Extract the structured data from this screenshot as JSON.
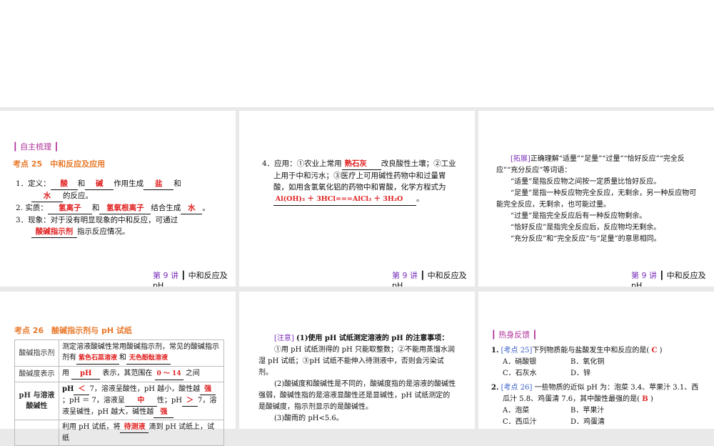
{
  "slide1": {
    "section": "自主梳理",
    "kaodian": "考点 25　中和反应及应用",
    "l1a": "1．定义：",
    "b_acid": "酸",
    "and1": "和",
    "b_base": "碱",
    "mid1": "作用生成",
    "b_salt": "盐",
    "and2": "和",
    "b_water": "水",
    "end1": "的反应。",
    "l2a": "2. 实质：",
    "b_h": "氢离子",
    "and3": "和",
    "b_oh": "氢氧根离子",
    "mid2": "结合生成",
    "b_water2": "水",
    "end2": "。",
    "l3a": "3．现象：对于没有明显现象的中和反应，可通过",
    "b_ind": "酸碱指示剂",
    "end3": "指示反应情况。"
  },
  "slide2": {
    "l1": "4．应用：①农业上常用",
    "b_lime": "熟石灰",
    "l1b": "改良酸性土壤；②工业上用于中和污水；③医疗上可用碱性药物中和过量胃酸，如用含氢氧化铝的药物中和胃酸，化学方程式为",
    "b_eq": "Al(OH)₃ ＋ 3HCl===AlCl₃ ＋ 3H₂O",
    "end": "。"
  },
  "slide3": {
    "tag": "[拓展]",
    "p0": "正确理解“适量”“足量”“过量”“恰好反应”“完全反应”“充分反应”等词语：",
    "p1": "“适量”是指反应物之间按一定质量比恰好反应。",
    "p2": "“足量”是指一种反应物完全反应，无剩余，另一种反应物可能完全反应，无剩余，也可能过量。",
    "p3": "“过量”是指完全反应后有一种反应物剩余。",
    "p4": "“恰好反应”是指完全反应后，反应物均无剩余。",
    "p5": "“充分反应”和“完全反应”与“足量”的意思相同。"
  },
  "footer": {
    "num": "第 9 讲",
    "sep": "┃",
    "title": "中和反应及pH"
  },
  "slide4": {
    "kaodian": "考点 26　酸碱指示剂与 pH 试纸",
    "r1h": "酸碱指示剂",
    "r1a": "测定溶液酸碱性常用酸碱指示剂，常见的酸碱指示剂有",
    "r1b1": "紫色石蕊溶液",
    "r1and": "和",
    "r1b2": "无色酚酞溶液",
    "r2h": "酸碱度表示",
    "r2a": "用",
    "r2b1": "pH",
    "r2c": "表示，其范围在",
    "r2b2": "0 ～ 14",
    "r2d": "之间",
    "r3h": "pH 与溶液酸碱性",
    "r3a": "pH",
    "r3b1": "＜",
    "r3c": "7，溶液呈酸性，pH 越小，酸性越",
    "r3b2": "强",
    "r3d": "；pH ＝ 7，溶液呈",
    "r3b3": "中",
    "r3e": "性；pH",
    "r3b4": "＞",
    "r3f": "7，溶液呈碱性，pH 越大，碱性越",
    "r3b5": "强",
    "r4a": "利用 pH 试纸，将",
    "r4b": "待测液",
    "r4c": "滴到 pH 试纸上，试纸"
  },
  "slide5": {
    "tag": "[注意]",
    "p1": "(1)使用 pH 试纸测定溶液的 pH 的注意事项：",
    "p2": "①用 pH 试纸测得的 pH 只能取整数；②不能用蒸馏水润湿 pH 试纸；③pH 试纸不能伸入待测液中，否则会污染试剂。",
    "p3": "(2)酸碱度和酸碱性是不同的，酸碱度指的是溶液的酸碱性强弱，酸碱性指的是溶液显酸性还是显碱性，pH 试纸测定的是酸碱度，指示剂显示的是酸碱性。",
    "p4": "(3)酸雨的 pH<5.6。"
  },
  "slide6": {
    "section": "热身反馈",
    "q1n": "1.",
    "q1tag": "[考点 25]",
    "q1": "下列物质能与盐酸发生中和反应的是(",
    "q1ans": "C",
    "q1end": ")",
    "q1A": "A．硝酸银",
    "q1B": "B．氧化铜",
    "q1C": "C．石灰水",
    "q1D": "D．锌",
    "q2n": "2.",
    "q2tag": "[考点 26]",
    "q2": "一些物质的近似 pH 为：泡菜 3.4、苹果汁 3.1、西瓜汁 5.8、鸡蛋清 7.6，其中酸性最强的是(",
    "q2ans": "B",
    "q2end": ")",
    "q2A": "A．泡菜",
    "q2B": "B．苹果汁",
    "q2C": "C．西瓜汁",
    "q2D": "D．鸡蛋清"
  }
}
